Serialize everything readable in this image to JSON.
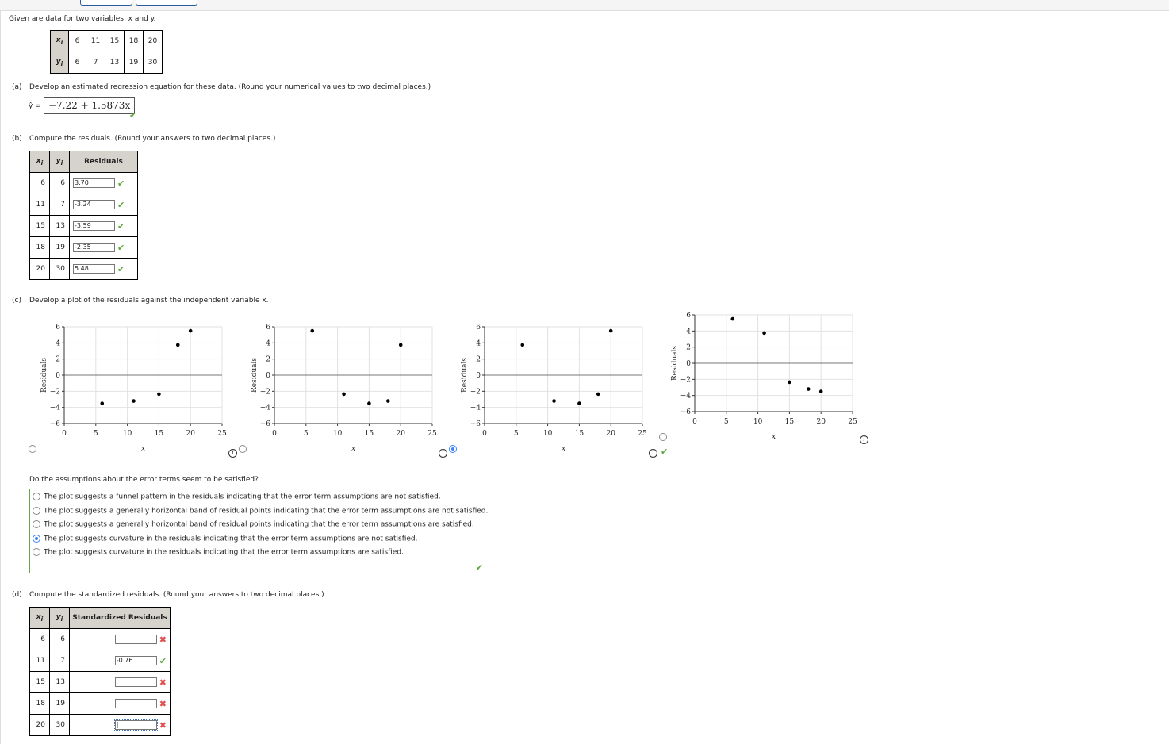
{
  "intro": {
    "text": "Given are data for two variables, x and y."
  },
  "data_table": {
    "x_label": "xi",
    "y_label": "yi",
    "x": [
      "6",
      "11",
      "15",
      "18",
      "20"
    ],
    "y": [
      "6",
      "7",
      "13",
      "19",
      "30"
    ]
  },
  "part_a": {
    "label": "(a)",
    "prompt": "Develop an estimated regression equation for these data. (Round your numerical values to two decimal places.)",
    "yhat_label": "ŷ =",
    "answer": "−7.22 + 1.5873x",
    "status": "correct"
  },
  "part_b": {
    "label": "(b)",
    "prompt": "Compute the residuals. (Round your answers to two decimal places.)",
    "headers": [
      "xi",
      "yi",
      "Residuals"
    ],
    "rows": [
      {
        "x": "6",
        "y": "6",
        "value": "3.70",
        "status": "correct"
      },
      {
        "x": "11",
        "y": "7",
        "value": "-3.24",
        "status": "correct"
      },
      {
        "x": "15",
        "y": "13",
        "value": "-3.59",
        "status": "correct"
      },
      {
        "x": "18",
        "y": "19",
        "value": "-2.35",
        "status": "correct"
      },
      {
        "x": "20",
        "y": "30",
        "value": "5.48",
        "status": "correct"
      }
    ]
  },
  "part_c": {
    "label": "(c)",
    "prompt": "Develop a plot of the residuals against the independent variable x.",
    "selected_plot": 3,
    "question": "Do the assumptions about the error terms seem to be satisfied?",
    "options": [
      "The plot suggests a funnel pattern in the residuals indicating that the error term assumptions are not satisfied.",
      "The plot suggests a generally horizontal band of residual points indicating that the error term assumptions are not satisfied.",
      "The plot suggests a generally horizontal band of residual points indicating that the error term assumptions are satisfied.",
      "The plot suggests curvature in the residuals indicating that the error term assumptions are not satisfied.",
      "The plot suggests curvature in the residuals indicating that the error term assumptions are satisfied."
    ],
    "selected_option": 3,
    "status": "correct"
  },
  "chart_data": [
    {
      "type": "scatter",
      "xlabel": "x",
      "ylabel": "Residuals",
      "xlim": [
        0,
        25
      ],
      "ylim": [
        -6,
        6
      ],
      "xticks": [
        "0",
        "5",
        "10",
        "15",
        "20",
        "25"
      ],
      "yticks": [
        "−6",
        "−4",
        "−2",
        "0",
        "2",
        "4",
        "6"
      ],
      "grid": true,
      "points": [
        [
          6,
          -3.5
        ],
        [
          11,
          -3.2
        ],
        [
          15,
          -2.35
        ],
        [
          18,
          3.75
        ],
        [
          20,
          5.5
        ]
      ]
    },
    {
      "type": "scatter",
      "xlabel": "x",
      "ylabel": "Residuals",
      "xlim": [
        0,
        25
      ],
      "ylim": [
        -6,
        6
      ],
      "xticks": [
        "0",
        "5",
        "10",
        "15",
        "20",
        "25"
      ],
      "yticks": [
        "−6",
        "−4",
        "−2",
        "0",
        "2",
        "4",
        "6"
      ],
      "grid": true,
      "points": [
        [
          6,
          5.5
        ],
        [
          11,
          -2.35
        ],
        [
          15,
          -3.5
        ],
        [
          18,
          -3.2
        ],
        [
          20,
          3.75
        ]
      ]
    },
    {
      "type": "scatter",
      "xlabel": "x",
      "ylabel": "Residuals",
      "xlim": [
        0,
        25
      ],
      "ylim": [
        -6,
        6
      ],
      "xticks": [
        "0",
        "5",
        "10",
        "15",
        "20",
        "25"
      ],
      "yticks": [
        "−6",
        "−4",
        "−2",
        "0",
        "2",
        "4",
        "6"
      ],
      "grid": true,
      "points": [
        [
          6,
          3.75
        ],
        [
          11,
          -3.2
        ],
        [
          15,
          -3.5
        ],
        [
          18,
          -2.35
        ],
        [
          20,
          5.5
        ]
      ]
    },
    {
      "type": "scatter",
      "xlabel": "x",
      "ylabel": "Residuals",
      "xlim": [
        0,
        25
      ],
      "ylim": [
        -6,
        6
      ],
      "xticks": [
        "0",
        "5",
        "10",
        "15",
        "20",
        "25"
      ],
      "yticks": [
        "−6",
        "−4",
        "−2",
        "0",
        "2",
        "4",
        "6"
      ],
      "grid": true,
      "points": [
        [
          6,
          5.5
        ],
        [
          11,
          3.75
        ],
        [
          15,
          -2.35
        ],
        [
          18,
          -3.2
        ],
        [
          20,
          -3.5
        ]
      ]
    }
  ],
  "part_d": {
    "label": "(d)",
    "prompt": "Compute the standardized residuals. (Round your answers to two decimal places.)",
    "headers": [
      "xi",
      "yi",
      "Standardized Residuals"
    ],
    "rows": [
      {
        "x": "6",
        "y": "6",
        "value": "",
        "status": "incorrect"
      },
      {
        "x": "11",
        "y": "7",
        "value": "-0.76",
        "status": "correct"
      },
      {
        "x": "15",
        "y": "13",
        "value": "",
        "status": "incorrect"
      },
      {
        "x": "18",
        "y": "19",
        "value": "",
        "status": "incorrect"
      },
      {
        "x": "20",
        "y": "30",
        "value": "",
        "status": "incorrect"
      }
    ]
  },
  "colors": {
    "correct": "#5aa83a",
    "incorrect": "#e05050",
    "selected": "#3b82f6",
    "option_border": "#6aa84f",
    "header_bg": "#d6d3cc"
  }
}
